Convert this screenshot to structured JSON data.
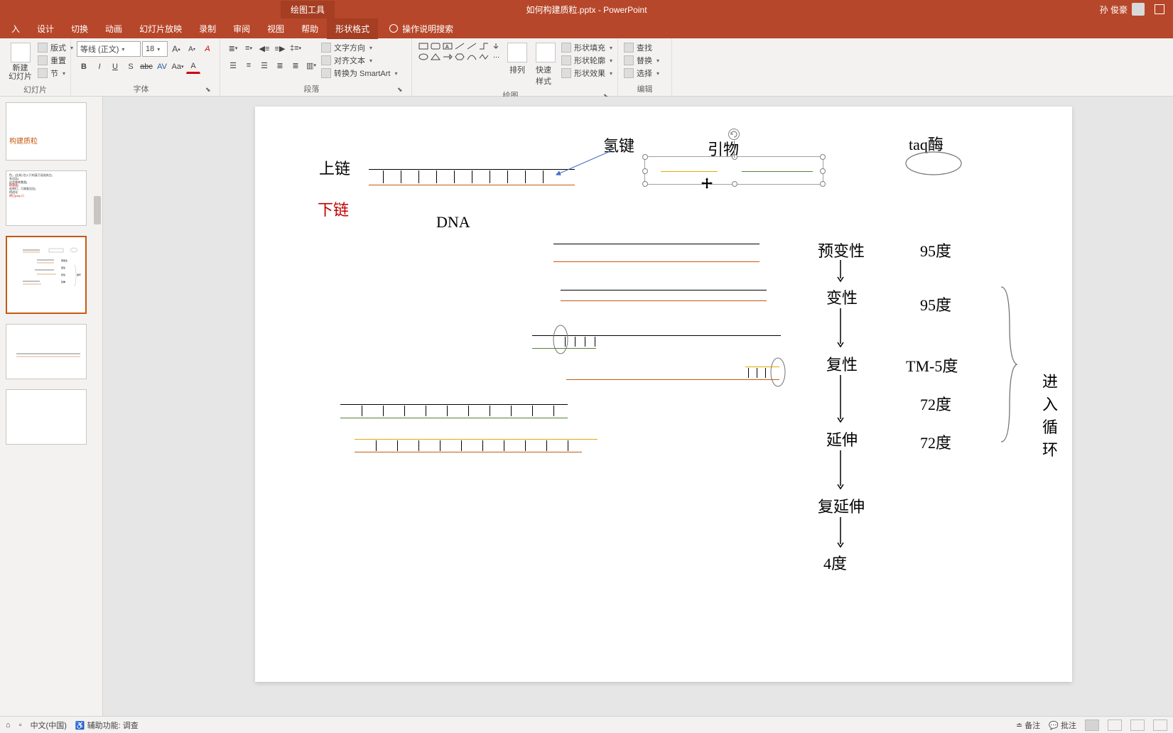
{
  "titlebar": {
    "tool_tab": "绘图工具",
    "filename": "如何构建质粒.pptx - PowerPoint",
    "user": "孙 俊豪"
  },
  "tabs": {
    "insert": "入",
    "design": "设计",
    "transition": "切换",
    "animation": "动画",
    "slideshow": "幻灯片放映",
    "record": "录制",
    "review": "审阅",
    "view": "视图",
    "help": "帮助",
    "shape_format": "形状格式",
    "tellme": "操作说明搜索"
  },
  "ribbon": {
    "slides": {
      "new_slide": "新建\n幻灯片",
      "layout": "版式",
      "reset": "重置",
      "section": "节",
      "label": "幻灯片"
    },
    "font": {
      "family": "等线 (正文)",
      "size": "18",
      "label": "字体"
    },
    "paragraph": {
      "text_direction": "文字方向",
      "align_text": "对齐文本",
      "smartart": "转换为 SmartArt",
      "label": "段落"
    },
    "drawing": {
      "arrange": "排列",
      "quick_styles": "快速样式",
      "shape_fill": "形状填充",
      "shape_outline": "形状轮廓",
      "shape_effects": "形状效果",
      "label": "绘图"
    },
    "editing": {
      "find": "查找",
      "replace": "替换",
      "select": "选择",
      "label": "编辑"
    }
  },
  "slide_content": {
    "hydrogen_bond": "氢键",
    "upper_strand": "上链",
    "lower_strand": "下链",
    "dna": "DNA",
    "primer": "引物",
    "taq": "taq酶",
    "pre_denature": "预变性",
    "denature": "变性",
    "anneal": "复性",
    "extend": "延伸",
    "re_extend": "复延伸",
    "temp_4": "4度",
    "temp_95_1": "95度",
    "temp_95_2": "95度",
    "tm_minus5": "TM-5度",
    "temp_72_1": "72度",
    "temp_72_2": "72度",
    "enter_cycle": "进入循环"
  },
  "thumb1_title": "构建质粒",
  "statusbar": {
    "language": "中文(中国)",
    "accessibility": "辅助功能: 调查",
    "notes": "备注",
    "comments": "批注"
  }
}
